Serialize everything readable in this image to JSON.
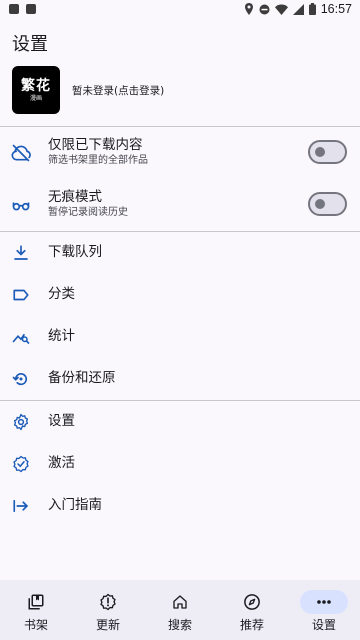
{
  "status_bar": {
    "time": "16:57"
  },
  "page": {
    "title": "设置"
  },
  "profile": {
    "logo_big": "繁花",
    "logo_small": "漫画",
    "login_text": "暂未登录(点击登录)"
  },
  "settings": {
    "downloaded_only": {
      "title": "仅限已下载内容",
      "subtitle": "筛选书架里的全部作品",
      "enabled": false
    },
    "incognito": {
      "title": "无痕模式",
      "subtitle": "暂停记录阅读历史",
      "enabled": false
    },
    "download_queue": {
      "title": "下载队列"
    },
    "categories": {
      "title": "分类"
    },
    "stats": {
      "title": "统计"
    },
    "backup": {
      "title": "备份和还原"
    },
    "settings": {
      "title": "设置"
    },
    "activate": {
      "title": "激活"
    },
    "guide": {
      "title": "入门指南"
    }
  },
  "bottom_nav": {
    "items": [
      {
        "label": "书架",
        "icon": "library-icon"
      },
      {
        "label": "更新",
        "icon": "updates-icon"
      },
      {
        "label": "搜索",
        "icon": "home-icon"
      },
      {
        "label": "推荐",
        "icon": "compass-icon"
      },
      {
        "label": "设置",
        "icon": "more-icon",
        "active": true
      }
    ]
  },
  "colors": {
    "accent": "#1b5bb8",
    "background": "#fbf8fd",
    "nav_bg": "#eeedf6",
    "active_pill": "#d8e2ff"
  }
}
